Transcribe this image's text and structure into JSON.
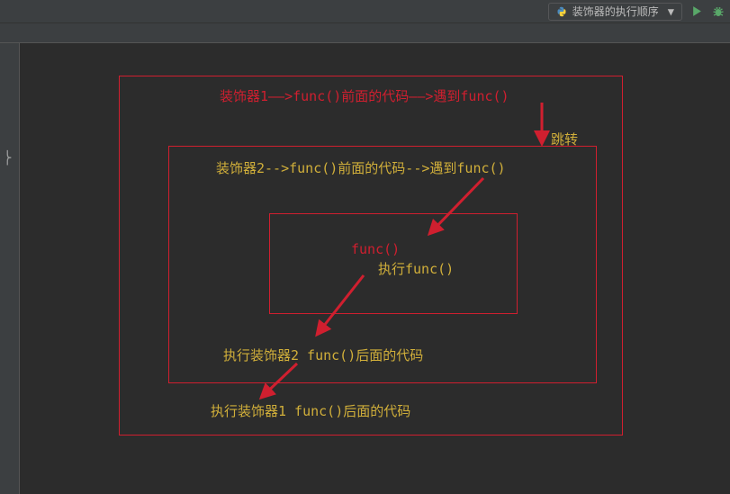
{
  "toolbar": {
    "run_config_label": "装饰器的执行顺序"
  },
  "diagram": {
    "box1_title": "装饰器1——>func()前面的代码——>遇到func()",
    "jump_label": "跳转",
    "box2_title": "装饰器2-->func()前面的代码-->遇到func()",
    "func_label": "func()",
    "exec_func_label": "执行func()",
    "exec_decorator2": "执行装饰器2 func()后面的代码",
    "exec_decorator1": "执行装饰器1 func()后面的代码"
  }
}
